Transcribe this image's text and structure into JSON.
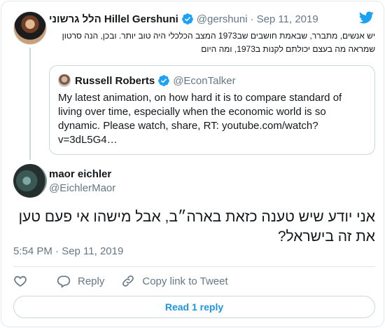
{
  "parent": {
    "name": "הלל גרשוני Hillel Gershuni",
    "handle": "@gershuni",
    "date": "Sep 11, 2019",
    "text": "יש אנשים, מתברר, שבאמת חושבים שב1973 המצב הכלכלי היה טוב יותר. ובכן, הנה סרטון שמראה מה בעצם יכולתם לקנות ב1973, ומה היום"
  },
  "quoted": {
    "name": "Russell Roberts",
    "handle": "@EconTalker",
    "text": "My latest animation, on how hard it is to compare standard of living over time, especially when the economic world is so dynamic. Please watch, share, RT: youtube.com/watch?v=3dL5G4…"
  },
  "reply": {
    "name": "maor eichler",
    "handle": "@EichlerMaor",
    "text": "אני יודע שיש טענה כזאת בארה״ב, אבל מישהו אי פעם טען את זה בישראל?",
    "time": "5:54 PM · Sep 11, 2019"
  },
  "actions": {
    "reply_label": "Reply",
    "copy_label": "Copy link to Tweet"
  },
  "read_replies_label": "Read 1 reply",
  "icons": {
    "like": "heart-icon",
    "reply": "speech-bubble-icon",
    "copy": "link-icon",
    "verified": "verified-badge-icon",
    "brand": "twitter-bird-icon"
  },
  "colors": {
    "brand": "#1da1f2",
    "link": "#1b95e0",
    "muted": "#657786",
    "border": "#e1e8ed"
  }
}
